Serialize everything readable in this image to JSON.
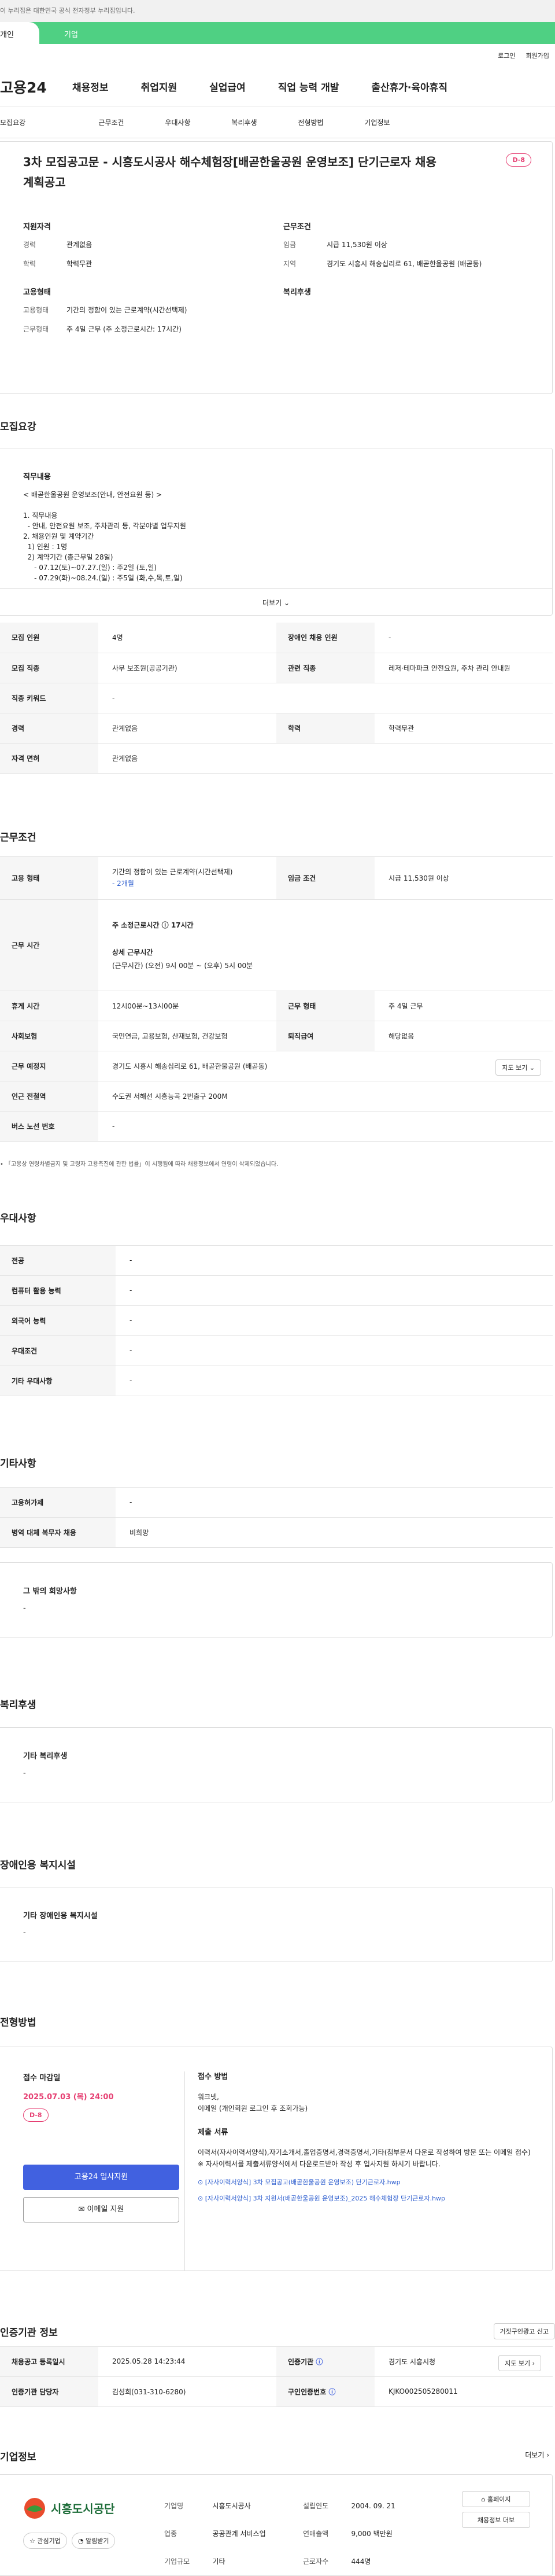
{
  "top_notice": "이 누리집은 대한민국 공식 전자정부 누리집입니다.",
  "gov_tabs": [
    "개인",
    "기업"
  ],
  "util": [
    "로그인",
    "회원가입"
  ],
  "logo": "고용24",
  "gnb": [
    "채용정보",
    "취업지원",
    "실업급여",
    "직업 능력 개발",
    "출산휴가·육아휴직"
  ],
  "subnav": [
    "모집요강",
    "근무조건",
    "우대사항",
    "복리후생",
    "전형방법",
    "기업정보"
  ],
  "job": {
    "title": "3차 모집공고문 - 시흥도시공사 해수체험장[배곧한울공원 운영보조] 단기근로자 채용계획공고",
    "dday": "D-8",
    "qual_title": "지원자격",
    "qual": [
      [
        "경력",
        "관계없음"
      ],
      [
        "학력",
        "학력무관"
      ]
    ],
    "cond_title": "근무조건",
    "cond": [
      [
        "임금",
        "시급 11,530원 이상"
      ],
      [
        "지역",
        "경기도 시흥시 해송십리로 61, 배곧한울공원 (배곧동)"
      ]
    ],
    "emp_title": "고용형태",
    "emp": [
      [
        "고용형태",
        "기간의 정함이 있는 근로계약(시간선택제)"
      ],
      [
        "근무형태",
        "주 4일 근무 (주 소정근로시간: 17시간)"
      ]
    ],
    "welfare_title": "복리후생"
  },
  "recruit": {
    "section": "모집요강",
    "desc_title": "직무내용",
    "desc": [
      "< 배곧한울공원 운영보조(안내, 안전요원 등) >",
      "",
      "1. 직무내용",
      "  - 안내, 안전요원 보조, 주차관리 등, 각분야별 업무지원",
      "2. 채용인원 및 계약기간",
      "  1) 인원 : 1명",
      "  2) 계약기간 (총근무일 28일)",
      "     - 07.12(토)~07.27.(일) : 주2일 (토,일)",
      "     - 07.29(화)~08.24.(일) : 주5일 (화,수,목,토,일)"
    ],
    "more": "더보기",
    "rows": [
      [
        "모집 인원",
        "4명",
        "장애인 채용 인원",
        "-"
      ],
      [
        "모집 직종",
        "사무 보조원(공공기관)",
        "관련 직종",
        "레저·테마파크 안전요원, 주차 관리 안내원"
      ],
      [
        "직종 키워드",
        "-"
      ],
      [
        "경력",
        "관계없음",
        "학력",
        "학력무관"
      ],
      [
        "자격 면허",
        "관계없음"
      ]
    ]
  },
  "work": {
    "section": "근무조건",
    "emp_type": "기간의 정함이 있는 근로계약(시간선택제)",
    "emp_months": "- 2개월",
    "wage_label": "임금 조건",
    "wage": "시급 11,530원 이상",
    "hours_label": "근무 시간",
    "week_hours": "주 소정근로시간 ⓘ 17시간",
    "hours_detail_t": "상세 근무시간",
    "hours_detail": "(근무시간) (오전) 9시 00분 ~ (오후) 5시 00분",
    "rows": [
      [
        "휴게 시간",
        "12시00분~13시00분",
        "근무 형태",
        "주 4일 근무"
      ],
      [
        "사회보험",
        "국민연금, 고용보험, 산재보험, 건강보험",
        "퇴직급여",
        "해당없음"
      ]
    ],
    "place_label": "근무 예정지",
    "place": "경기도 시흥시 해송십리로 61, 배곧한울공원 (배곧동)",
    "map_btn": "지도 보기",
    "subway_label": "인근 전철역",
    "subway": "수도권 서해선 시흥능곡 2번출구 200M",
    "bus_label": "버스 노선 번호",
    "bus": "-",
    "note": "「고용상 연령차별금지 및 고령자 고용촉진에 관한 법률」이 시행됨에 따라 채용정보에서 연령이 삭제되었습니다."
  },
  "pref": {
    "section": "우대사항",
    "rows": [
      [
        "전공",
        "-"
      ],
      [
        "컴퓨터 활용 능력",
        "-"
      ],
      [
        "외국어 능력",
        "-"
      ],
      [
        "우대조건",
        "-"
      ],
      [
        "기타 우대사항",
        "-"
      ]
    ]
  },
  "etc": {
    "section": "기타사항",
    "rows": [
      [
        "고용허가제",
        "-"
      ],
      [
        "병역 대체 복무자 채용",
        "비희망"
      ]
    ],
    "other_t": "그 밖의 희망사항",
    "other": "-"
  },
  "welfare": {
    "section": "복리후생",
    "t": "기타 복리후생",
    "v": "-"
  },
  "disabled": {
    "section": "장애인용 복지시설",
    "t": "기타 장애인용 복지시설",
    "v": "-"
  },
  "process": {
    "section": "전형방법",
    "deadline_t": "접수 마감일",
    "deadline": "2025.07.03 (목) 24:00",
    "dday": "D-8",
    "apply_btn": "고용24 입사지원",
    "mail_btn": "이메일 지원",
    "method_t": "접수 방법",
    "method": [
      "워크넷,",
      "이메일 (개인회원 로그인 후 조회가능)"
    ],
    "docs_t": "제출 서류",
    "docs": "이력서(자사이력서양식),자기소개서,졸업증명서,경력증명서,기타(첨부문서 다운로 작성하여 방문 또는 이메일 접수)",
    "docs_note": "※ 자사이력서를 제출서류양식에서 다운로드받아 작성 후 입사지원 하시기 바랍니다.",
    "files": [
      "[자사이력서양식] 3차 모집공고(배곧한울공원 운영보조) 단기근로자.hwp",
      "[자사이력서양식] 3차 지원서(배곧한울공원 운영보조)_2025 해수체험장 단기근로자.hwp"
    ]
  },
  "cert": {
    "section": "인증기관 정보",
    "report": "거짓구인광고 신고",
    "rows": [
      [
        "채용공고 등록일시",
        "2025.05.28 14:23:44",
        "인증기관",
        "경기도 시흥시청"
      ],
      [
        "인증기관 담당자",
        "김성희(031-310-6280)",
        "구인인증번호",
        "KJKO002505280011"
      ]
    ],
    "map": "지도 보기"
  },
  "company": {
    "section": "기업정보",
    "more": "더보기",
    "logo": "시흥도시공단",
    "fav": "관심기업",
    "alert": "알림받기",
    "info": [
      [
        "기업명",
        "시흥도시공사",
        "설립연도",
        "2004. 09. 21"
      ],
      [
        "업종",
        "공공관계 서비스업",
        "연매출액",
        "9,000 백만원"
      ],
      [
        "기업규모",
        "기타",
        "근로자수",
        "444명"
      ]
    ],
    "home_btn": "홈페이지",
    "jobs_btn": "채용정보 더보"
  }
}
